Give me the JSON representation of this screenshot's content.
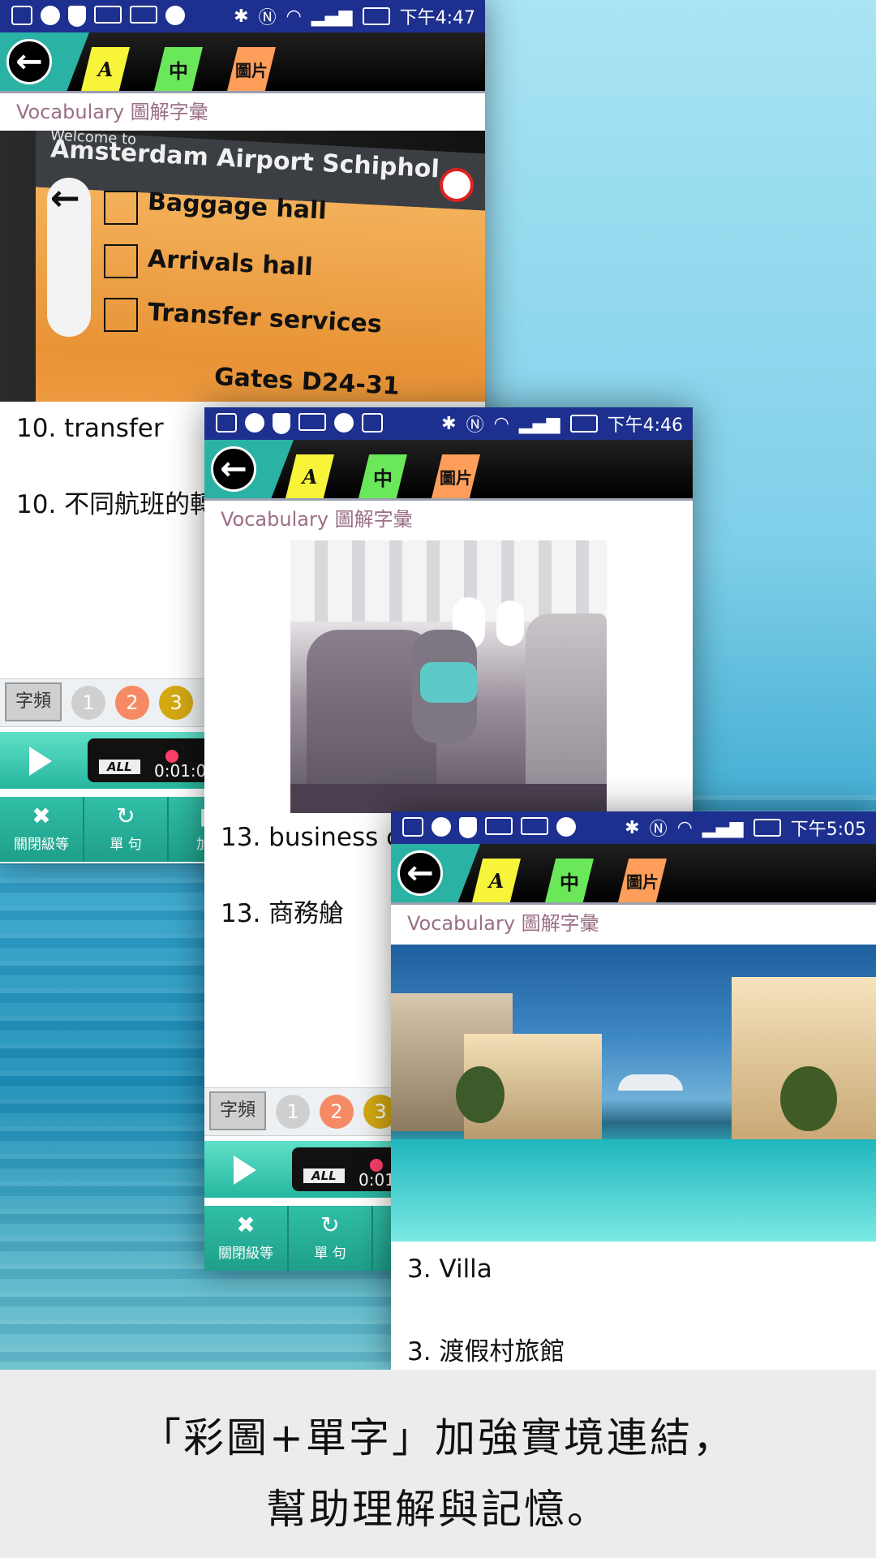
{
  "status_bars": [
    {
      "time": "下午4:47"
    },
    {
      "time": "下午4:46"
    },
    {
      "time": "下午5:05"
    }
  ],
  "appbar": {
    "back_label": "←",
    "tag_a": "A",
    "tag_zh": "中",
    "tag_pic": "圖片",
    "section_title": "Vocabulary 圖解字彙"
  },
  "screens": [
    {
      "photo_desc": "Airport direction sign",
      "sign_lines": {
        "header": "Amsterdam Airport Schiphol",
        "welcome": "Welcome to",
        "line1": "Baggage hall",
        "line2": "Arrivals hall",
        "line3": "Transfer services",
        "gates": "Gates D24-31"
      },
      "english": "10. transfer",
      "chinese": "10. 不同航班的轉",
      "freq_label": "字頻",
      "freq_levels": [
        "1",
        "2",
        "3"
      ],
      "player": {
        "mode": "ALL",
        "time": "0:01:0"
      },
      "tools": [
        {
          "icon": "✖",
          "label": "關閉級等"
        },
        {
          "icon": "↻",
          "label": "單 句"
        },
        {
          "icon": "◧",
          "label": "加入"
        }
      ]
    },
    {
      "english": "13. business c",
      "chinese": "13. 商務艙",
      "freq_label": "字頻",
      "freq_levels": [
        "1",
        "2",
        "3"
      ],
      "player": {
        "mode": "ALL",
        "time": "0:01"
      },
      "tools": [
        {
          "icon": "✖",
          "label": "關閉級等"
        },
        {
          "icon": "↻",
          "label": "單 句"
        }
      ]
    },
    {
      "english": "3. Villa",
      "chinese": "3. 渡假村旅館"
    }
  ],
  "caption": {
    "line1": "「彩圖+單字」加強實境連結，",
    "line2": "幫助理解與記憶。"
  },
  "colors": {
    "status_bar": "#1d2f8f",
    "teal": "#2ab3a4",
    "tag_yellow": "#f7f43a",
    "tag_green": "#6be85a",
    "tag_orange": "#ff9e5a",
    "freq_1": "#cfcfcf",
    "freq_2": "#f58a64",
    "freq_3": "#d4a912"
  }
}
